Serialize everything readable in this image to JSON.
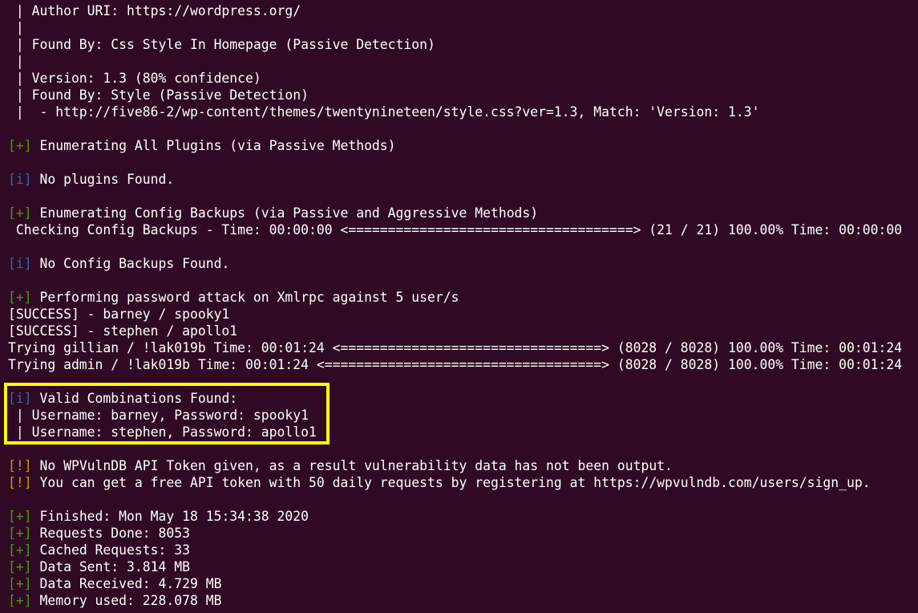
{
  "terminal": {
    "theme": {
      "background": "#300a24",
      "text": "#ffffff",
      "green_tag": "#4e9a06",
      "blue_tag": "#3465a4",
      "yellow_tag": "#c4a000",
      "highlight_border": "#ffff00"
    },
    "tags": {
      "plus": "[+]",
      "info": "[i]",
      "warn": "[!]"
    },
    "lines": {
      "author_uri": " | Author URI: https://wordpress.org/",
      "pipe1": " |",
      "found_by_css": " | Found By: Css Style In Homepage (Passive Detection)",
      "pipe2": " |",
      "version": " | Version: 1.3 (80% confidence)",
      "found_by_style": " | Found By: Style (Passive Detection)",
      "style_match": " |  - http://five86-2/wp-content/themes/twentynineteen/style.css?ver=1.3, Match: 'Version: 1.3'",
      "enum_plugins": " Enumerating All Plugins (via Passive Methods)",
      "no_plugins": " No plugins Found.",
      "enum_config": " Enumerating Config Backups (via Passive and Aggressive Methods)",
      "checking_config": " Checking Config Backups - Time: 00:00:00 <====================================> (21 / 21) 100.00% Time: 00:00:00",
      "no_config": " No Config Backups Found.",
      "pwd_attack": " Performing password attack on Xmlrpc against 5 user/s",
      "success1": "[SUCCESS] - barney / spooky1",
      "success2": "[SUCCESS] - stephen / apollo1",
      "trying_gillian": "Trying gillian / !lak019b Time: 00:01:24 <=================================> (8028 / 8028) 100.00% Time: 00:01:24",
      "trying_admin": "Trying admin / !lak019b Time: 00:01:24 <===================================> (8028 / 8028) 100.00% Time: 00:01:24",
      "valid_combos": " Valid Combinations Found:",
      "combo1": " | Username: barney, Password: spooky1",
      "combo2": " | Username: stephen, Password: apollo1",
      "no_token": " No WPVulnDB API Token given, as a result vulnerability data has not been output.",
      "free_token": " You can get a free API token with 50 daily requests by registering at https://wpvulndb.com/users/sign_up.",
      "finished": " Finished: Mon May 18 15:34:38 2020",
      "requests_done": " Requests Done: 8053",
      "cached_requests": " Cached Requests: 33",
      "data_sent": " Data Sent: 3.814 MB",
      "data_received": " Data Received: 4.729 MB",
      "memory_used": " Memory used: 228.078 MB"
    }
  }
}
